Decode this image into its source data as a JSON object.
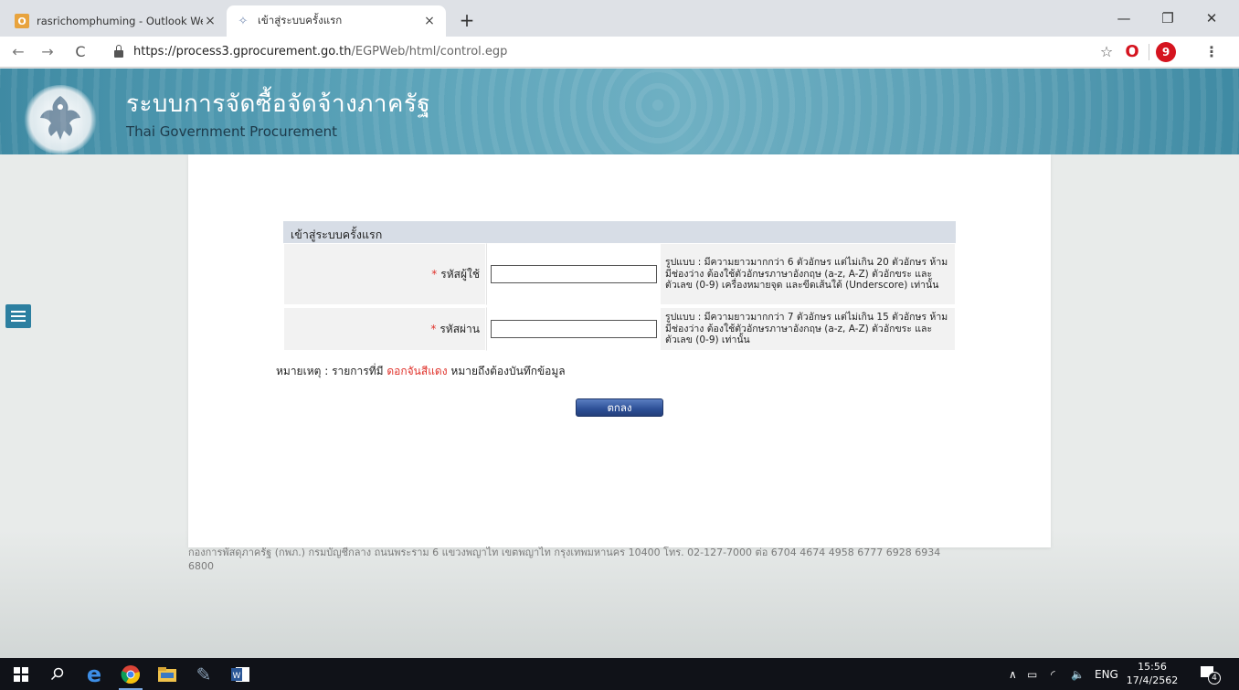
{
  "browser": {
    "tabs": [
      {
        "title": "rasrichomphuming - Outlook We",
        "favicon": "outlook-icon"
      },
      {
        "title": "เข้าสู่ระบบครั้งแรก",
        "favicon": "egp-icon"
      }
    ],
    "url_host": "https://process3.gprocurement.go.th",
    "url_path": "/EGPWeb/html/control.egp",
    "profile_initial": "9"
  },
  "header": {
    "title": "ระบบการจัดซื้อจัดจ้างภาครัฐ",
    "subtitle": "Thai Government Procurement",
    "seal_text": "กรมบัญชีกลาง"
  },
  "form": {
    "heading": "เข้าสู่ระบบครั้งแรก",
    "required_mark": "*",
    "fields": [
      {
        "label": "รหัสผู้ใช้",
        "value": "",
        "hint": "รูปแบบ : มีความยาวมากกว่า 6 ตัวอักษร แต่ไม่เกิน 20 ตัวอักษร ห้ามมีช่องว่าง ต้องใช้ตัวอักษรภาษาอังกฤษ (a-z, A-Z) ตัวอักขระ และตัวเลข (0-9) เครื่องหมายจุด และขีดเส้นใต้ (Underscore) เท่านั้น"
      },
      {
        "label": "รหัสผ่าน",
        "value": "",
        "hint": "รูปแบบ : มีความยาวมากกว่า 7 ตัวอักษร แต่ไม่เกิน 15 ตัวอักษร ห้ามมีช่องว่าง ต้องใช้ตัวอักษรภาษาอังกฤษ (a-z, A-Z) ตัวอักขระ และตัวเลข (0-9) เท่านั้น"
      }
    ],
    "note_prefix": "หมายเหตุ : รายการที่มี ",
    "note_red": "ดอกจันสีแดง",
    "note_suffix": " หมายถึงต้องบันทึกข้อมูล",
    "submit_label": "ตกลง"
  },
  "footer": {
    "text": "กองการพัสดุภาครัฐ (กพภ.) กรมบัญชีกลาง ถนนพระราม 6 แขวงพญาไท เขตพญาไท กรุงเทพมหานคร 10400 โทร. 02-127-7000 ต่อ 6704 4674 4958 6777 6928 6934 6800"
  },
  "taskbar": {
    "language": "ENG",
    "time": "15:56",
    "date": "17/4/2562",
    "notification_count": "4"
  },
  "colors": {
    "banner": "#5aa2b8",
    "required": "#e0332c",
    "button": "#2c4f96"
  }
}
